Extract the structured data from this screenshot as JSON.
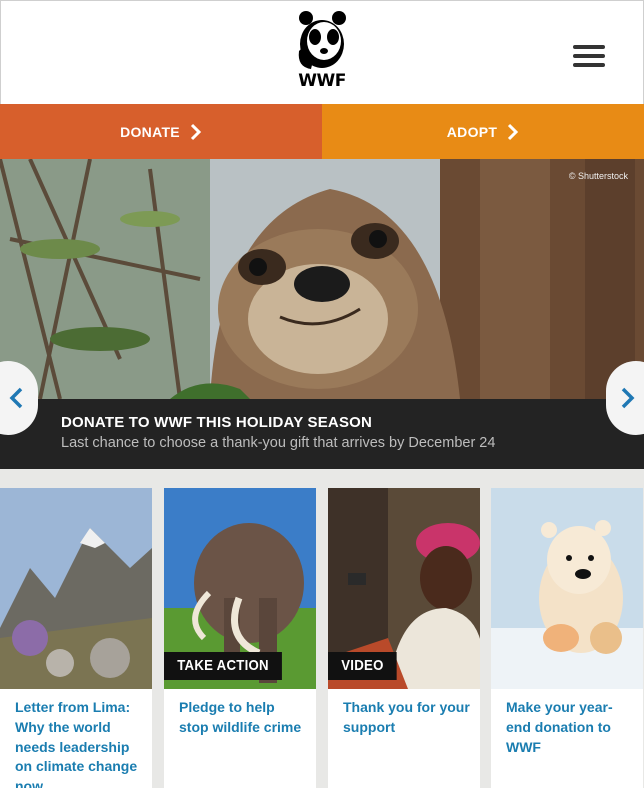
{
  "header": {
    "logo_text": "WWF",
    "menu_icon": "hamburger-menu-icon"
  },
  "cta": {
    "donate_label": "DONATE",
    "adopt_label": "ADOPT"
  },
  "hero": {
    "credit": "© Shutterstock",
    "title": "DONATE TO WWF THIS HOLIDAY SEASON",
    "subtitle": "Last chance to choose a thank-you gift that arrives by December 24"
  },
  "cards": [
    {
      "text": "Letter from Lima: Why the world needs leadership on climate change now",
      "tag": ""
    },
    {
      "text": "Pledge to help stop wildlife crime",
      "tag": "TAKE ACTION"
    },
    {
      "text": "Thank you for your support",
      "tag": "VIDEO"
    },
    {
      "text": "Make your year-end donation to WWF",
      "tag": ""
    }
  ],
  "colors": {
    "donate": "#d75f2c",
    "adopt": "#e88b15",
    "link": "#1a7db0",
    "caption_bg": "#232323"
  }
}
